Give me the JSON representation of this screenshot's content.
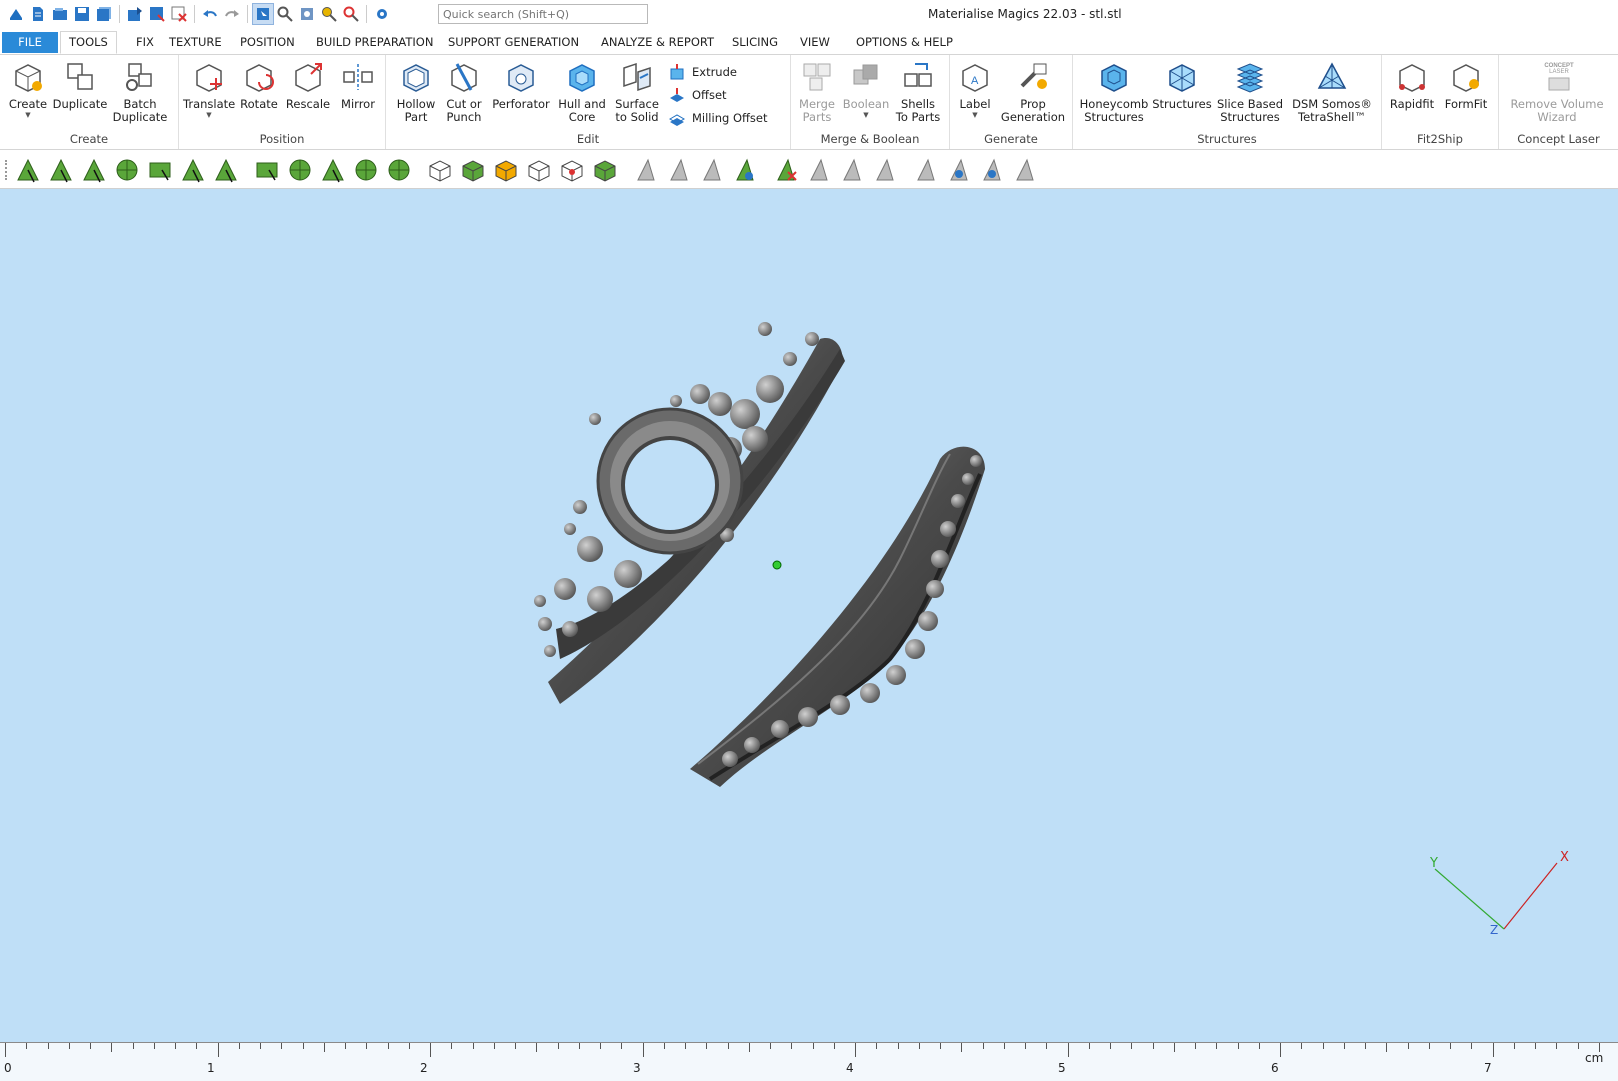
{
  "window": {
    "title": "Materialise Magics 22.03 - stl.stl"
  },
  "quick_access": {
    "search_placeholder": "Quick search (Shift+Q)",
    "icons": [
      "magics-logo-icon",
      "new-file-icon",
      "open-icon",
      "save-icon",
      "save-all-icon",
      "import-icon",
      "save-as-icon",
      "close-part-icon",
      "undo-icon",
      "redo-icon",
      "select-mode-icon",
      "zoom-icon",
      "zoom-box-icon",
      "magnify-icon",
      "zoom-part-icon",
      "settings-icon"
    ]
  },
  "tabs": [
    "FILE",
    "TOOLS",
    "FIX",
    "TEXTURE",
    "POSITION",
    "BUILD PREPARATION",
    "SUPPORT GENERATION",
    "ANALYZE & REPORT",
    "SLICING",
    "VIEW",
    "OPTIONS & HELP"
  ],
  "active_tab": "TOOLS",
  "ribbon": {
    "create": {
      "label": "Create",
      "buttons": [
        "Create",
        "Duplicate",
        "Batch\nDuplicate"
      ]
    },
    "position": {
      "label": "Position",
      "buttons": [
        "Translate",
        "Rotate",
        "Rescale",
        "Mirror"
      ]
    },
    "edit": {
      "label": "Edit",
      "buttons": [
        "Hollow\nPart",
        "Cut or\nPunch",
        "Perforator",
        "Hull and\nCore",
        "Surface\nto Solid"
      ],
      "small": [
        "Extrude",
        "Offset",
        "Milling Offset"
      ]
    },
    "merge": {
      "label": "Merge & Boolean",
      "buttons": [
        "Merge\nParts",
        "Boolean",
        "Shells\nTo Parts"
      ]
    },
    "generate": {
      "label": "Generate",
      "buttons": [
        "Label",
        "Prop\nGeneration"
      ]
    },
    "structures": {
      "label": "Structures",
      "buttons": [
        "Honeycomb\nStructures",
        "Structures",
        "Slice Based\nStructures",
        "DSM Somos®\nTetraShell™"
      ]
    },
    "fit2ship": {
      "label": "Fit2Ship",
      "buttons": [
        "Rapidfit",
        "FormFit"
      ]
    },
    "concept": {
      "label": "Concept Laser",
      "buttons": [
        "Remove Volume\nWizard"
      ],
      "logo_text": "CONCEPT\nLASER"
    }
  },
  "toolbar_icons": [
    "select-triangle-icon",
    "select-plane-icon",
    "select-surface-icon",
    "select-shell-icon",
    "select-box-icon",
    "select-lasso-icon",
    "select-curve-icon",
    "mark-box-icon",
    "mark-shell-icon",
    "mark-expand-icon",
    "mark-wheel-icon",
    "mark-sphere-icon",
    "select-part-icon",
    "select-part-green-icon",
    "select-part-colored-icon",
    "unselect-part-icon",
    "select-part-red-icon",
    "select-part-all-icon",
    "triangle-gray-icon",
    "triangle-edge-icon",
    "triangle-arrow-icon",
    "triangle-color-icon",
    "triangle-delete-icon",
    "triangle-split-icon",
    "triangle-doc-icon",
    "triangle-flat-icon",
    "triangle-outline-icon",
    "triangle-spin-icon",
    "triangle-eye-icon",
    "triangle-hatch-icon"
  ],
  "viewport": {
    "background": "#bfdff7",
    "axes": {
      "x": "X",
      "y": "Y",
      "z": "Z",
      "x_color": "#cc2222",
      "y_color": "#33aa33",
      "z_color": "#3366cc"
    }
  },
  "ruler": {
    "labels": [
      "0",
      "1",
      "2",
      "3",
      "4",
      "5",
      "6",
      "7"
    ],
    "unit": "cm"
  }
}
